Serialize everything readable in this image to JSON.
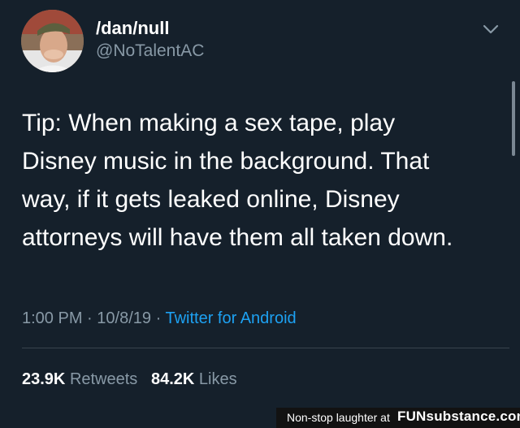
{
  "tweet": {
    "author": {
      "display_name": "/dan/null",
      "handle": "@NoTalentAC",
      "avatar_icon": "profile-photo"
    },
    "caret_icon": "chevron-down-icon",
    "text_lines": [
      "Tip: When making a sex tape, play",
      "Disney music in the background. That",
      "way, if it gets leaked online, Disney",
      "attorneys will have them all taken down."
    ],
    "meta": {
      "time": "1:00 PM",
      "sep1": "·",
      "date": "10/8/19",
      "sep2": "·",
      "source": "Twitter for Android"
    },
    "stats": {
      "retweets_count": "23.9K",
      "retweets_label": "Retweets",
      "likes_count": "84.2K",
      "likes_label": "Likes"
    }
  },
  "watermark": {
    "text": "Non-stop laughter at",
    "brand": "FUNsubstance.com"
  },
  "colors": {
    "background": "#15202b",
    "primary_text": "#ffffff",
    "secondary_text": "#8899a6",
    "link": "#1da1f2",
    "divider": "#38444d"
  }
}
